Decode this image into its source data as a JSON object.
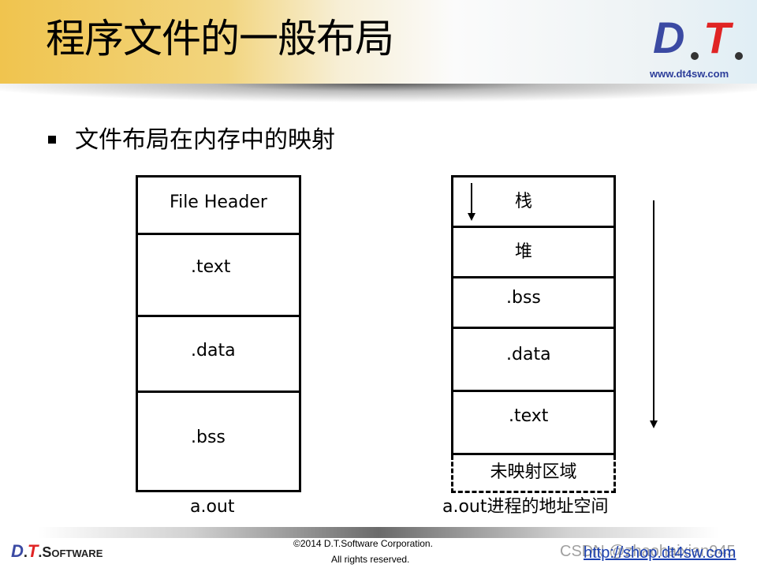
{
  "header": {
    "title": "程序文件的一般布局",
    "logo": {
      "d": "D",
      "t": "T",
      "url": "www.dt4sw.com"
    }
  },
  "content": {
    "bullet": "文件布局在内存中的映射",
    "file_layout": {
      "segments": [
        "File Header",
        ".text",
        ".data",
        ".bss"
      ],
      "caption": "a.out"
    },
    "process_layout": {
      "segments": [
        "栈",
        "堆",
        ".bss",
        ".data",
        ".text"
      ],
      "unmapped": "未映射区域",
      "caption": "a.out进程的地址空间"
    }
  },
  "footer": {
    "logo": {
      "d": "D",
      "t": "T",
      "software": ".Software"
    },
    "copyright": "©2014 D.T.Software Corporation.",
    "rights": "All rights reserved.",
    "link": "http://shop.dt4sw.com",
    "watermark": "CSDN @zhaohaixian945"
  },
  "colors": {
    "brand_blue": "#3b4aa3",
    "brand_red": "#e02424",
    "link": "#1a3fb0"
  }
}
